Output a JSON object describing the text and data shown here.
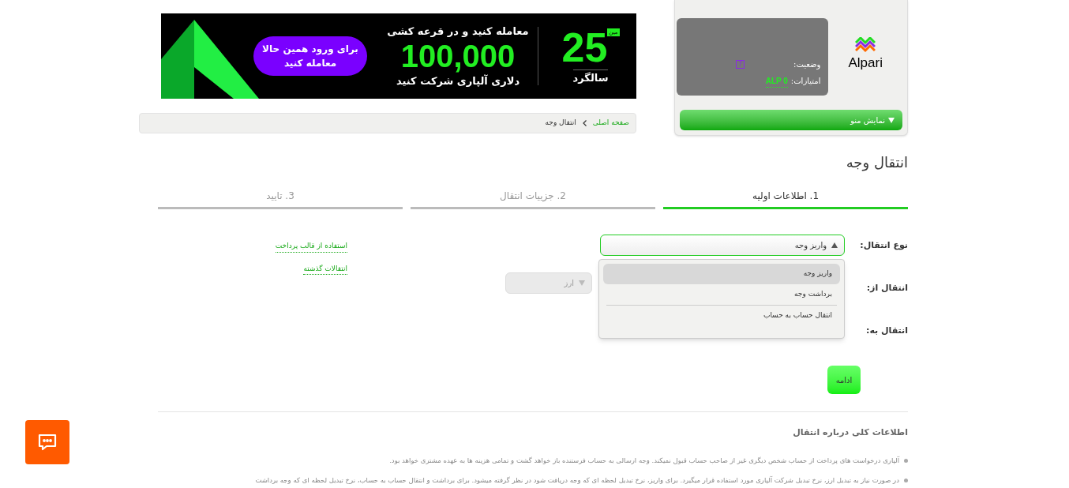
{
  "banner": {
    "badge_number": "25",
    "badge_suffix": "مین",
    "badge_label": "سالگرد",
    "headline": "معامله کنید و در قرعه کشی",
    "amount": "100,000",
    "subline": "دلاری آلپاری شرکت کنید",
    "cta": "برای ورود همین حالا معامله کنید"
  },
  "profile": {
    "logo_text": "Alpari",
    "status_label": "وضعیت:",
    "points_label": "امتیازات:",
    "points_value": "ALP 0",
    "help": "?",
    "menu_button": "نمایش منو"
  },
  "breadcrumb": [
    {
      "label": "صفحه اصلی",
      "link": true
    },
    {
      "label": "انتقال وجه",
      "link": false
    }
  ],
  "title": "انتقال وجه",
  "steps": [
    {
      "label": "1. اطلاعات اولیه",
      "selected": true
    },
    {
      "label": "2. جزییات انتقال",
      "selected": false
    },
    {
      "label": "3. تایید",
      "selected": false
    }
  ],
  "form": {
    "fields": [
      {
        "label": "نوع انتقال:",
        "kind": "select",
        "value": "واریز وجه",
        "expanded": true,
        "disabled": false
      },
      {
        "label": "انتقال از:",
        "kind": "select",
        "value": "ارز",
        "expanded": false,
        "disabled": true
      },
      {
        "label": "انتقال به:",
        "kind": "empty"
      }
    ],
    "dropdown_options": [
      {
        "label": "واریز وجه",
        "selected": true
      },
      {
        "label": "برداشت وجه",
        "selected": false
      },
      {
        "label": "انتقال حساب به حساب",
        "selected": false
      }
    ],
    "links": [
      "استفاده از قالب پرداخت",
      "انتقالات گذشته"
    ],
    "submit": "ادامه"
  },
  "info": {
    "title": "اطلاعات کلی درباره انتقال",
    "items": [
      "آلپاری درخواست های پرداخت از حساب شخص دیگری غیر از صاحب حساب قبول نمیکند. وجه ارسالی به حساب فرستنده باز خواهد گشت و تمامی هزینه ها به عهده مشتری خواهد بود.",
      "در صورت نیاز به تبدیل ارز، نرخ تبدیل شرکت آلپاری مورد استفاده قرار میگیرد. برای واریز، نرخ تبدیل لحظه ای که وجه دریافت شود در نظر گرفته میشود. برای برداشت و انتقال حساب به حساب، نرخ تبدیل لحظه ای که وجه برداشت"
    ]
  }
}
